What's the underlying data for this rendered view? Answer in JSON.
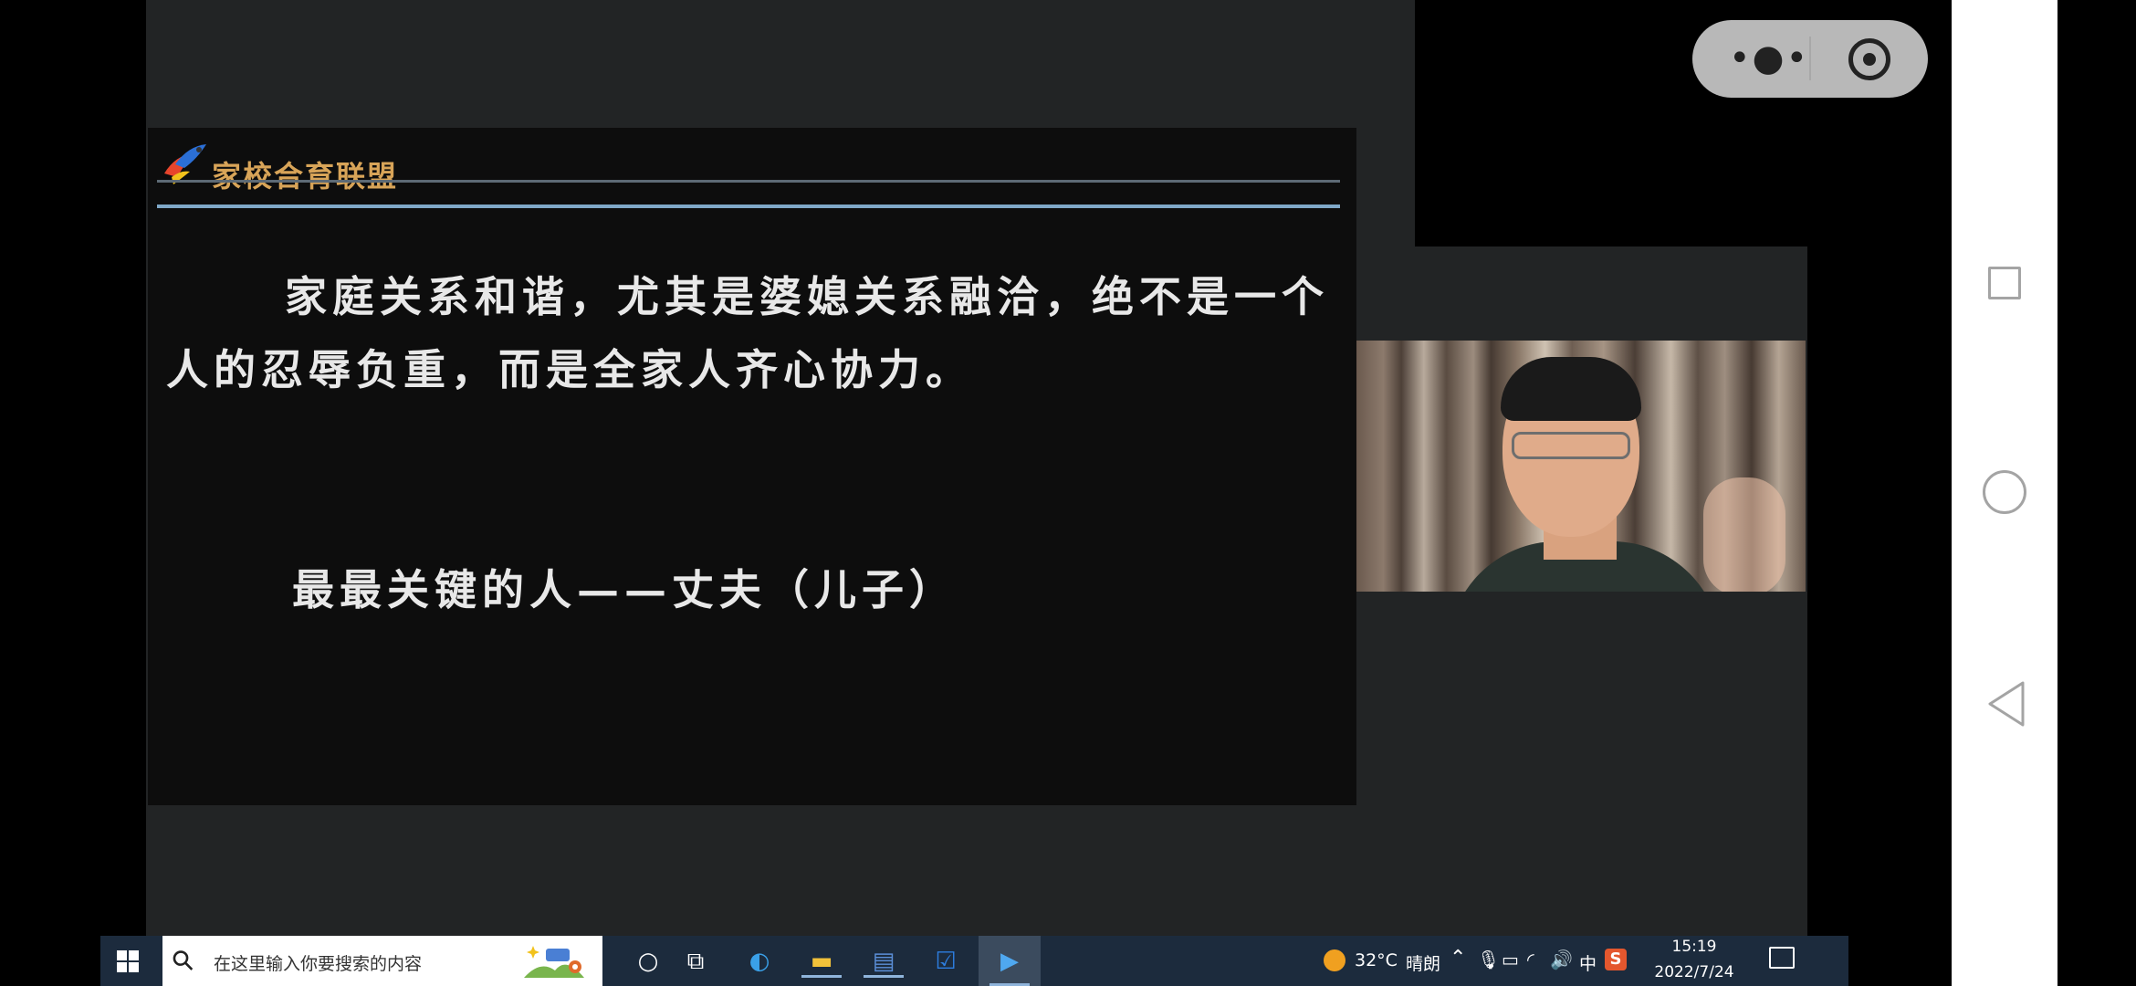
{
  "slide": {
    "brand": "家校合育联盟",
    "paragraph": "家庭关系和谐，尤其是婆媳关系融洽，绝不是一个人的忍辱负重，而是全家人齐心协力。",
    "key_line": "最最关键的人——丈夫（儿子）"
  },
  "mini_program_capsule": {
    "more_icon": "more-icon",
    "close_icon": "record-icon",
    "more_glyph": "•●•"
  },
  "taskbar": {
    "search_placeholder": "在这里输入你要搜索的内容",
    "weather_temp": "32°C",
    "weather_text": "晴朗",
    "input_lang": "中",
    "ime_label": "S",
    "time": "15:19",
    "date": "2022/7/24"
  },
  "colors": {
    "background": "#000000",
    "video_bg": "#222425",
    "slide_bg": "#0d0d0d",
    "brand_text": "#d8a458",
    "taskbar": "#1c2b3d"
  }
}
